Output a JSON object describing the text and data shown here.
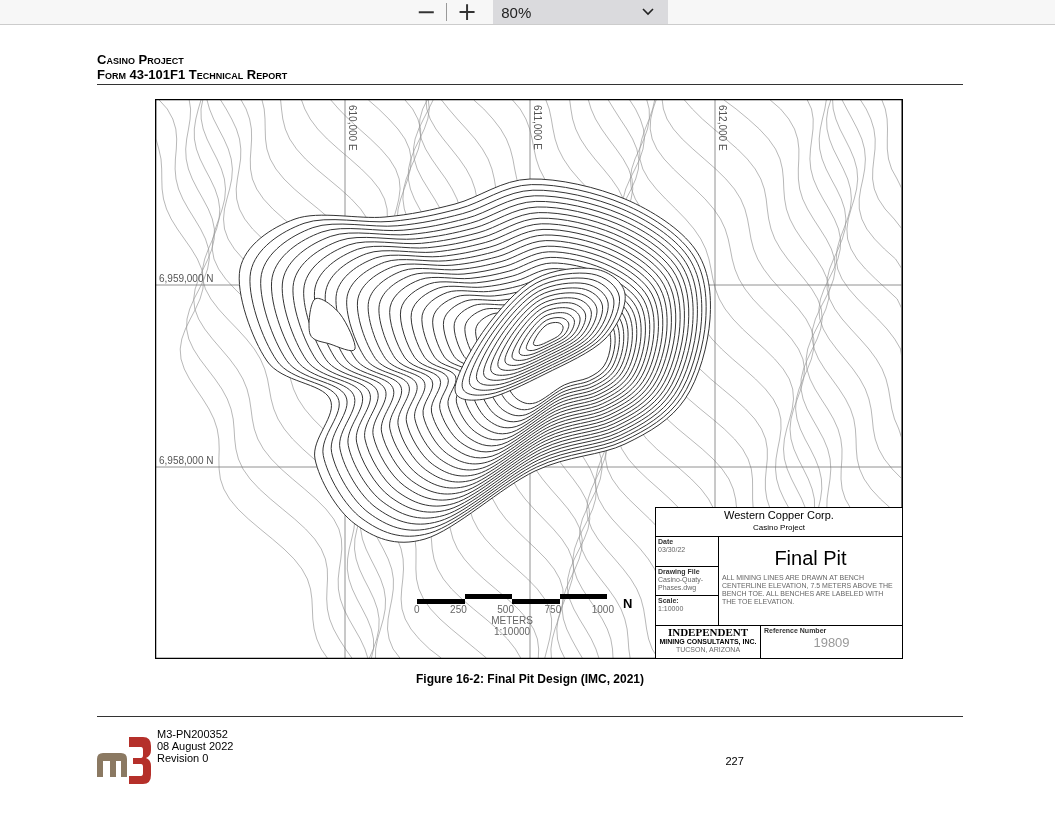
{
  "toolbar": {
    "zoom_out": "−",
    "zoom_in": "+",
    "zoom_value": "80%"
  },
  "header": {
    "line_1": "Casino Project",
    "line_2": "Form 43-101F1 Technical Report"
  },
  "map": {
    "easting_labels": [
      "610,000 E",
      "611,000 E",
      "612,000 E"
    ],
    "northing_labels": [
      "6,959,000 N",
      "6,958,000 N"
    ],
    "scale_bar": {
      "ticks": [
        "0",
        "250",
        "500",
        "750",
        "1000"
      ],
      "units": "METERS",
      "ratio": "1:10000",
      "north": "N"
    },
    "title_block": {
      "company": "Western Copper Corp.",
      "project": "Casino Project",
      "date_label": "Date",
      "date": "03/30/22",
      "file_label": "Drawing File",
      "file": "Casino-Quaty-Phases.dwg",
      "scale_label": "Scale:",
      "scale": "1:10000",
      "title": "Final Pit",
      "note": "ALL MINING LINES ARE DRAWN AT BENCH CENTERLINE ELEVATION, 7.5 METERS ABOVE THE BENCH TOE. ALL BENCHES ARE LABELED WITH THE TOE ELEVATION.",
      "firm": "INDEPENDENT",
      "firm_sub": "MINING CONSULTANTS, INC.",
      "firm_city": "TUCSON, ARIZONA",
      "ref_label": "Reference Number",
      "ref": "19809"
    }
  },
  "caption": "Figure 16-2: Final Pit Design (IMC, 2021)",
  "footer": {
    "lines": [
      "M3-PN200352",
      "08 August 2022",
      "Revision 0"
    ],
    "page_number": "227"
  }
}
